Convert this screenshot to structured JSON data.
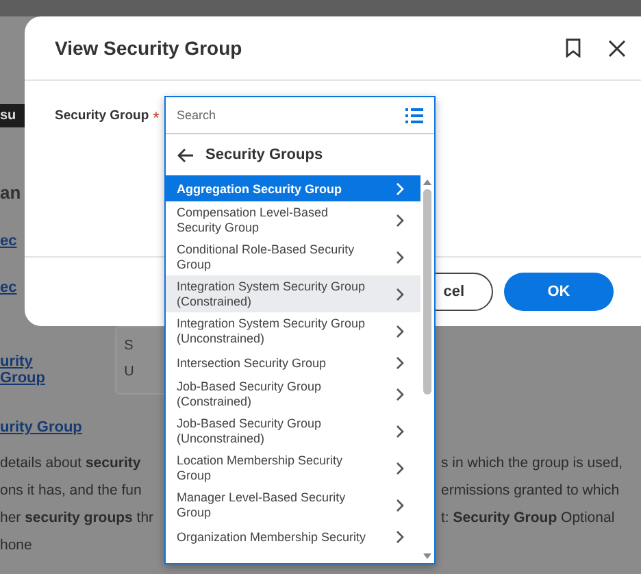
{
  "background": {
    "tab_fragment": "su",
    "heading_fragment": "an",
    "links": [
      "ec",
      "ec"
    ],
    "box_lines": [
      "S",
      "U"
    ],
    "lower_links": [
      "urity Group",
      "urity Group"
    ],
    "paragraph": [
      {
        "left": "details about **security**",
        "right": "s in which the group is used,"
      },
      {
        "left": "ons it has, and the fun",
        "right": "ermissions granted to which"
      },
      {
        "left": "her **security groups** thr",
        "right": "t: **Security Group** Optional"
      },
      {
        "left": "hone"
      }
    ]
  },
  "modal": {
    "title": "View Security Group",
    "field_label": "Security Group",
    "required_mark": "*",
    "buttons": [
      {
        "label": "cel",
        "kind": "secondary"
      },
      {
        "label": "OK",
        "kind": "primary"
      }
    ]
  },
  "dropdown": {
    "placeholder": "Search",
    "header": "Security Groups",
    "items": [
      {
        "label": "Aggregation Security Group",
        "selected": true,
        "hovered": false
      },
      {
        "label": "Compensation Level-Based Security Group",
        "selected": false,
        "hovered": false
      },
      {
        "label": "Conditional Role-Based Security Group",
        "selected": false,
        "hovered": false
      },
      {
        "label": "Integration System Security Group (Constrained)",
        "selected": false,
        "hovered": true
      },
      {
        "label": "Integration System Security Group (Unconstrained)",
        "selected": false,
        "hovered": false
      },
      {
        "label": "Intersection Security Group",
        "selected": false,
        "hovered": false
      },
      {
        "label": "Job-Based Security Group (Constrained)",
        "selected": false,
        "hovered": false
      },
      {
        "label": "Job-Based Security Group (Unconstrained)",
        "selected": false,
        "hovered": false
      },
      {
        "label": "Location Membership Security Group",
        "selected": false,
        "hovered": false
      },
      {
        "label": "Manager Level-Based Security Group",
        "selected": false,
        "hovered": false
      },
      {
        "label": "Organization Membership Security",
        "selected": false,
        "hovered": false
      }
    ]
  }
}
